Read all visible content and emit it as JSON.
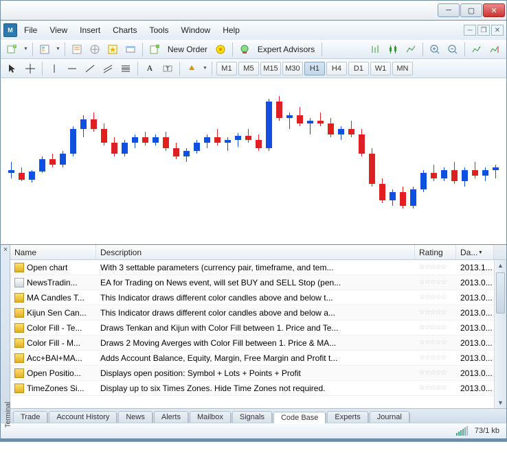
{
  "menu": {
    "items": [
      "File",
      "View",
      "Insert",
      "Charts",
      "Tools",
      "Window",
      "Help"
    ]
  },
  "toolbar1": {
    "new_order": "New Order",
    "expert_advisors": "Expert Advisors"
  },
  "timeframes": [
    "M1",
    "M5",
    "M15",
    "M30",
    "H1",
    "H4",
    "D1",
    "W1",
    "MN"
  ],
  "active_tf": "H1",
  "chart_data": {
    "type": "candlestick",
    "note": "values are approximate heights read from the unlabeled chart; no axis labels present in screenshot",
    "candles": [
      {
        "o": 48,
        "h": 54,
        "l": 42,
        "c": 46,
        "dir": "up"
      },
      {
        "o": 46,
        "h": 50,
        "l": 40,
        "c": 41,
        "dir": "down"
      },
      {
        "o": 41,
        "h": 48,
        "l": 39,
        "c": 47,
        "dir": "up"
      },
      {
        "o": 47,
        "h": 58,
        "l": 46,
        "c": 56,
        "dir": "up"
      },
      {
        "o": 56,
        "h": 60,
        "l": 50,
        "c": 52,
        "dir": "down"
      },
      {
        "o": 52,
        "h": 62,
        "l": 50,
        "c": 60,
        "dir": "up"
      },
      {
        "o": 60,
        "h": 80,
        "l": 58,
        "c": 78,
        "dir": "up"
      },
      {
        "o": 78,
        "h": 88,
        "l": 72,
        "c": 85,
        "dir": "up"
      },
      {
        "o": 85,
        "h": 90,
        "l": 76,
        "c": 78,
        "dir": "down"
      },
      {
        "o": 78,
        "h": 82,
        "l": 66,
        "c": 68,
        "dir": "down"
      },
      {
        "o": 68,
        "h": 72,
        "l": 58,
        "c": 60,
        "dir": "down"
      },
      {
        "o": 60,
        "h": 70,
        "l": 58,
        "c": 68,
        "dir": "up"
      },
      {
        "o": 68,
        "h": 74,
        "l": 64,
        "c": 72,
        "dir": "up"
      },
      {
        "o": 72,
        "h": 76,
        "l": 66,
        "c": 68,
        "dir": "down"
      },
      {
        "o": 68,
        "h": 74,
        "l": 66,
        "c": 72,
        "dir": "up"
      },
      {
        "o": 72,
        "h": 76,
        "l": 62,
        "c": 64,
        "dir": "down"
      },
      {
        "o": 64,
        "h": 68,
        "l": 56,
        "c": 58,
        "dir": "down"
      },
      {
        "o": 58,
        "h": 64,
        "l": 54,
        "c": 62,
        "dir": "up"
      },
      {
        "o": 62,
        "h": 70,
        "l": 60,
        "c": 68,
        "dir": "up"
      },
      {
        "o": 68,
        "h": 74,
        "l": 64,
        "c": 72,
        "dir": "up"
      },
      {
        "o": 72,
        "h": 78,
        "l": 66,
        "c": 68,
        "dir": "down"
      },
      {
        "o": 68,
        "h": 72,
        "l": 62,
        "c": 70,
        "dir": "up"
      },
      {
        "o": 70,
        "h": 75,
        "l": 65,
        "c": 73,
        "dir": "up"
      },
      {
        "o": 73,
        "h": 78,
        "l": 68,
        "c": 70,
        "dir": "down"
      },
      {
        "o": 70,
        "h": 74,
        "l": 62,
        "c": 64,
        "dir": "down"
      },
      {
        "o": 64,
        "h": 100,
        "l": 62,
        "c": 98,
        "dir": "up"
      },
      {
        "o": 98,
        "h": 102,
        "l": 84,
        "c": 86,
        "dir": "down"
      },
      {
        "o": 86,
        "h": 90,
        "l": 78,
        "c": 88,
        "dir": "up"
      },
      {
        "o": 88,
        "h": 94,
        "l": 80,
        "c": 82,
        "dir": "down"
      },
      {
        "o": 82,
        "h": 86,
        "l": 74,
        "c": 84,
        "dir": "up"
      },
      {
        "o": 84,
        "h": 90,
        "l": 80,
        "c": 82,
        "dir": "down"
      },
      {
        "o": 82,
        "h": 86,
        "l": 72,
        "c": 74,
        "dir": "down"
      },
      {
        "o": 74,
        "h": 80,
        "l": 70,
        "c": 78,
        "dir": "up"
      },
      {
        "o": 78,
        "h": 84,
        "l": 72,
        "c": 74,
        "dir": "down"
      },
      {
        "o": 74,
        "h": 78,
        "l": 58,
        "c": 60,
        "dir": "down"
      },
      {
        "o": 60,
        "h": 64,
        "l": 36,
        "c": 38,
        "dir": "down"
      },
      {
        "o": 38,
        "h": 42,
        "l": 24,
        "c": 26,
        "dir": "down"
      },
      {
        "o": 26,
        "h": 34,
        "l": 22,
        "c": 32,
        "dir": "up"
      },
      {
        "o": 32,
        "h": 36,
        "l": 20,
        "c": 22,
        "dir": "down"
      },
      {
        "o": 22,
        "h": 36,
        "l": 20,
        "c": 34,
        "dir": "up"
      },
      {
        "o": 34,
        "h": 48,
        "l": 32,
        "c": 46,
        "dir": "up"
      },
      {
        "o": 46,
        "h": 52,
        "l": 40,
        "c": 42,
        "dir": "down"
      },
      {
        "o": 42,
        "h": 50,
        "l": 40,
        "c": 48,
        "dir": "up"
      },
      {
        "o": 48,
        "h": 54,
        "l": 38,
        "c": 40,
        "dir": "down"
      },
      {
        "o": 40,
        "h": 50,
        "l": 36,
        "c": 48,
        "dir": "up"
      },
      {
        "o": 48,
        "h": 54,
        "l": 42,
        "c": 44,
        "dir": "down"
      },
      {
        "o": 44,
        "h": 50,
        "l": 40,
        "c": 48,
        "dir": "up"
      },
      {
        "o": 48,
        "h": 52,
        "l": 42,
        "c": 50,
        "dir": "up"
      }
    ]
  },
  "terminal": {
    "label": "Terminal",
    "columns": {
      "name": "Name",
      "desc": "Description",
      "rating": "Rating",
      "date": "Da..."
    },
    "rows": [
      {
        "ico": "y",
        "name": "Open chart",
        "desc": "With 3 settable parameters (currency pair, timeframe, and tem...",
        "date": "2013.1..."
      },
      {
        "ico": "s",
        "name": "NewsTradin...",
        "desc": "EA for Trading on News event, will set BUY and SELL Stop (pen...",
        "date": "2013.0..."
      },
      {
        "ico": "y",
        "name": "MA Candles T...",
        "desc": "This Indicator draws different color candles above and below t...",
        "date": "2013.0..."
      },
      {
        "ico": "y",
        "name": "Kijun Sen Can...",
        "desc": "This Indicator draws different color candles above and below a...",
        "date": "2013.0..."
      },
      {
        "ico": "y",
        "name": "Color Fill - Te...",
        "desc": "Draws Tenkan and Kijun with Color Fill between 1. Price and Te...",
        "date": "2013.0..."
      },
      {
        "ico": "y",
        "name": "Color Fill - M...",
        "desc": "Draws 2 Moving Averges with Color Fill between 1. Price & MA...",
        "date": "2013.0..."
      },
      {
        "ico": "y",
        "name": "Acc+BAl+MA...",
        "desc": "Adds Account Balance, Equity, Margin, Free Margin and Profit t...",
        "date": "2013.0..."
      },
      {
        "ico": "y",
        "name": "Open Positio...",
        "desc": "Displays open position: Symbol + Lots + Points + Profit",
        "date": "2013.0..."
      },
      {
        "ico": "y",
        "name": "TimeZones Si...",
        "desc": "Display up to six Times Zones. Hide Time Zones not required.",
        "date": "2013.0..."
      }
    ],
    "tabs": [
      "Trade",
      "Account History",
      "News",
      "Alerts",
      "Mailbox",
      "Signals",
      "Code Base",
      "Experts",
      "Journal"
    ],
    "active_tab": "Code Base"
  },
  "status": {
    "traffic": "73/1 kb"
  }
}
